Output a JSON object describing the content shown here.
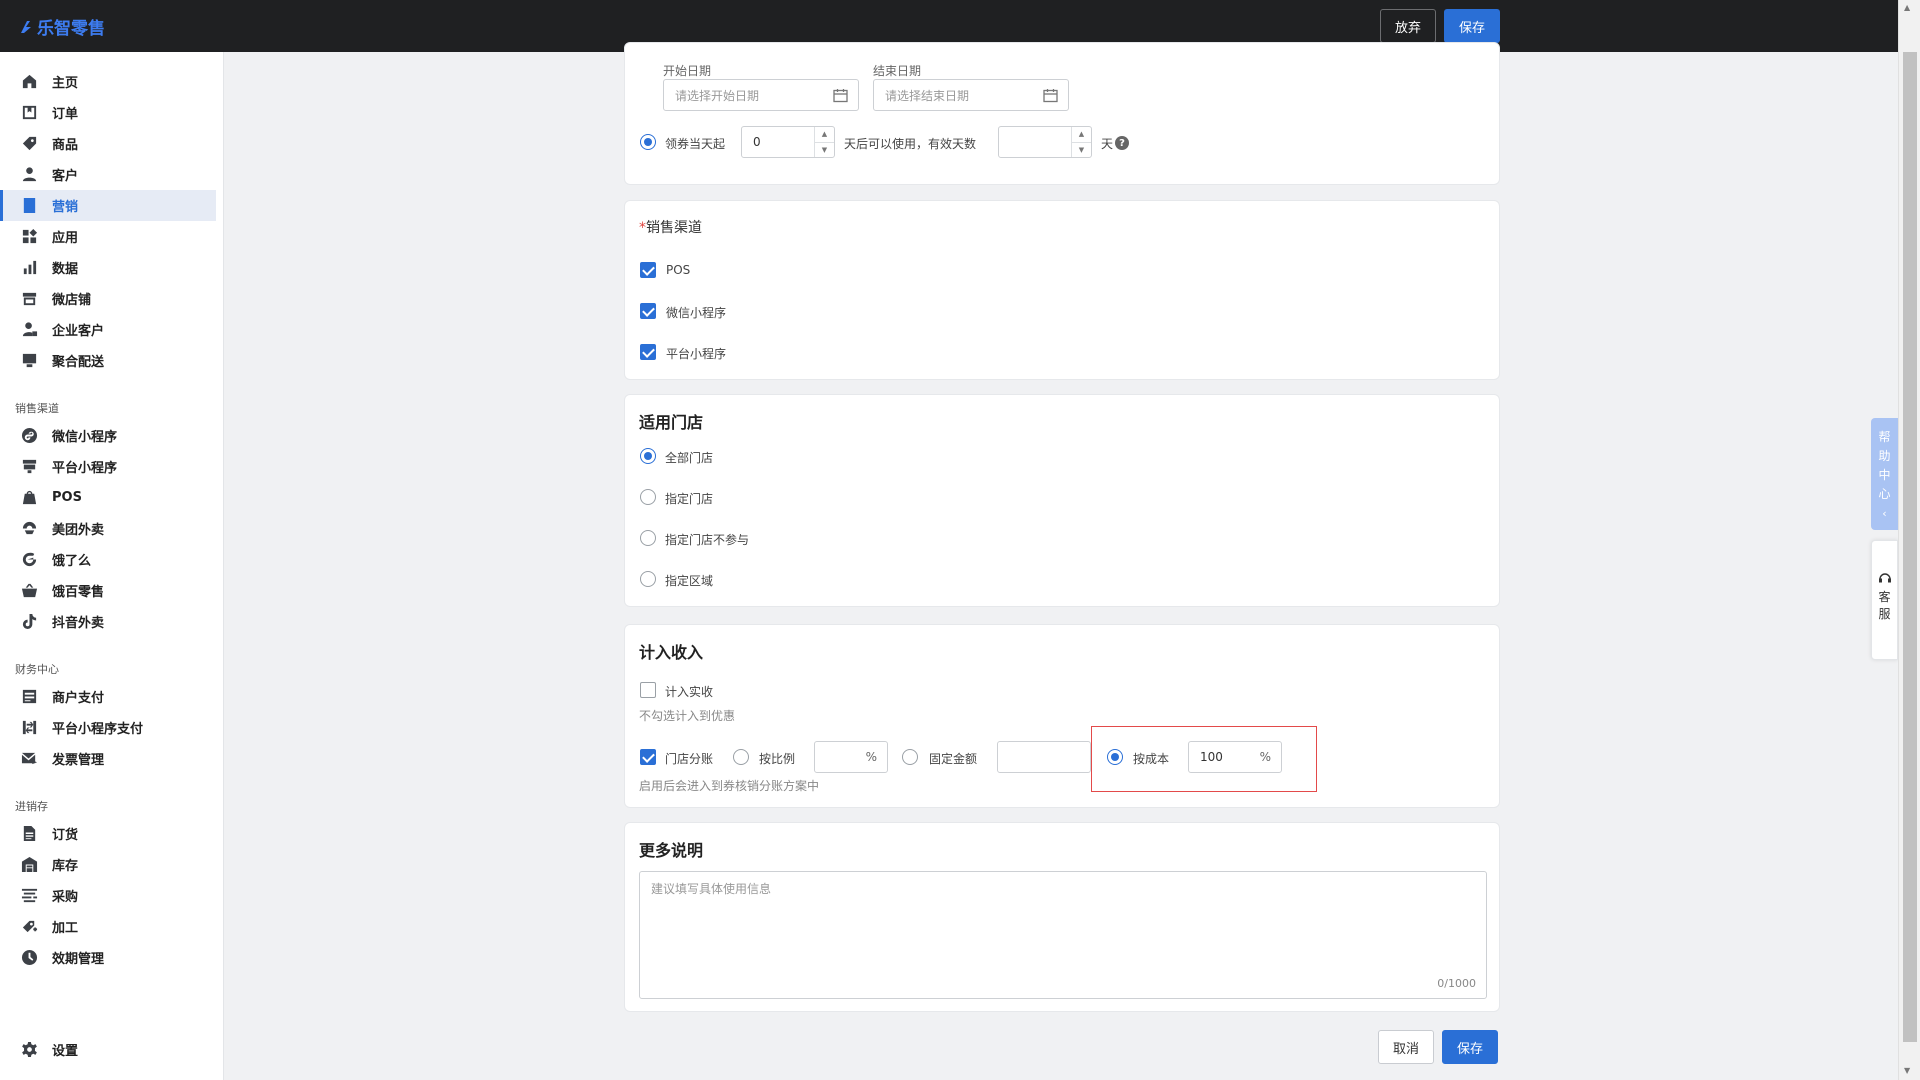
{
  "app": {
    "logo_text": "乐智零售",
    "brand_color": "#2a6fd6",
    "discard_label": "放弃",
    "save_label": "保存"
  },
  "sidebar": {
    "items": [
      {
        "label": "主页",
        "icon": "home-icon"
      },
      {
        "label": "订单",
        "icon": "order-icon"
      },
      {
        "label": "商品",
        "icon": "tag-icon"
      },
      {
        "label": "客户",
        "icon": "user-icon"
      },
      {
        "label": "营销",
        "icon": "marketing-icon",
        "active": true
      },
      {
        "label": "应用",
        "icon": "apps-icon"
      },
      {
        "label": "数据",
        "icon": "bar-chart-icon"
      },
      {
        "label": "微店铺",
        "icon": "store-icon"
      },
      {
        "label": "企业客户",
        "icon": "enterprise-user-icon"
      },
      {
        "label": "聚合配送",
        "icon": "delivery-icon"
      }
    ],
    "section_sales": "销售渠道",
    "sales_items": [
      {
        "label": "微信小程序",
        "icon": "wechat-mini-icon"
      },
      {
        "label": "平台小程序",
        "icon": "platform-mini-icon"
      },
      {
        "label": "POS",
        "icon": "pos-icon"
      },
      {
        "label": "美团外卖",
        "icon": "meituan-icon"
      },
      {
        "label": "饿了么",
        "icon": "eleme-icon"
      },
      {
        "label": "饿百零售",
        "icon": "basket-icon"
      },
      {
        "label": "抖音外卖",
        "icon": "douyin-icon"
      }
    ],
    "section_finance": "财务中心",
    "finance_items": [
      {
        "label": "商户支付",
        "icon": "merchant-pay-icon"
      },
      {
        "label": "平台小程序支付",
        "icon": "transfer-icon"
      },
      {
        "label": "发票管理",
        "icon": "invoice-icon"
      }
    ],
    "section_inventory": "进销存",
    "inventory_items": [
      {
        "label": "订货",
        "icon": "document-icon"
      },
      {
        "label": "库存",
        "icon": "warehouse-icon"
      },
      {
        "label": "采购",
        "icon": "purchase-icon"
      },
      {
        "label": "加工",
        "icon": "process-icon"
      },
      {
        "label": "效期管理",
        "icon": "clock-icon"
      }
    ],
    "settings_label": "设置"
  },
  "validity": {
    "start_label": "开始日期",
    "start_placeholder": "请选择开始日期",
    "end_label": "结束日期",
    "end_placeholder": "请选择结束日期",
    "from_day_label": "领券当天起",
    "from_day_value": "0",
    "after_days_label": "天后可以使用，有效天数",
    "valid_days_value": "",
    "day_unit": "天"
  },
  "channels": {
    "title": "销售渠道",
    "items": [
      {
        "label": "POS",
        "checked": true
      },
      {
        "label": "微信小程序",
        "checked": true
      },
      {
        "label": "平台小程序",
        "checked": true
      }
    ]
  },
  "stores": {
    "title": "适用门店",
    "options": [
      {
        "label": "全部门店",
        "selected": true
      },
      {
        "label": "指定门店",
        "selected": false
      },
      {
        "label": "指定门店不参与",
        "selected": false
      },
      {
        "label": "指定区域",
        "selected": false
      }
    ]
  },
  "income": {
    "title": "计入收入",
    "count_actual_label": "计入实收",
    "count_actual_checked": false,
    "hint": "不勾选计入到优惠",
    "store_split_label": "门店分账",
    "store_split_checked": true,
    "by_ratio_label": "按比例",
    "ratio_value": "",
    "percent": "%",
    "fixed_amount_label": "固定金额",
    "fixed_amount_value": "",
    "by_cost_label": "按成本",
    "cost_value": "100",
    "split_hint": "启用后会进入到券核销分账方案中"
  },
  "notes": {
    "title": "更多说明",
    "placeholder": "建议填写具体使用信息",
    "counter": "0/1000"
  },
  "footer": {
    "cancel_label": "取消",
    "save_label": "保存"
  },
  "widgets": {
    "help_chars": [
      "帮",
      "助",
      "中",
      "心"
    ],
    "service_chars": [
      "客",
      "服"
    ]
  }
}
